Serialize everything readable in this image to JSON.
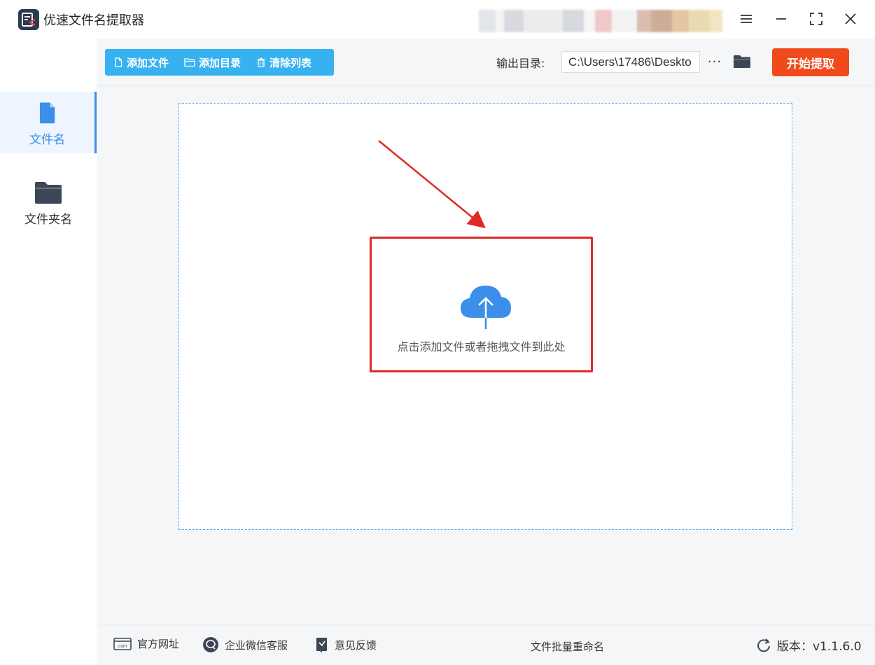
{
  "window": {
    "title": "优速文件名提取器"
  },
  "sidebar": {
    "items": [
      {
        "label": "文件名",
        "icon": "file-icon",
        "active": true
      },
      {
        "label": "文件夹名",
        "icon": "folder-icon",
        "active": false
      }
    ]
  },
  "toolbar": {
    "add_file": "添加文件",
    "add_dir": "添加目录",
    "clear_list": "清除列表"
  },
  "output": {
    "label": "输出目录:",
    "path": "C:\\Users\\17486\\Deskto",
    "more": "···"
  },
  "start_button": "开始提取",
  "dropzone": {
    "hint": "点击添加文件或者拖拽文件到此处"
  },
  "footer": {
    "website": "官方网址",
    "wechat": "企业微信客服",
    "feedback": "意见反馈",
    "promo": "文件批量重命名",
    "version": "版本：v1.1.6.0"
  },
  "colors": {
    "accent": "#3b8fe8",
    "toolbar": "#36b2f1",
    "start": "#f04a1c",
    "highlight": "#e02a24"
  }
}
